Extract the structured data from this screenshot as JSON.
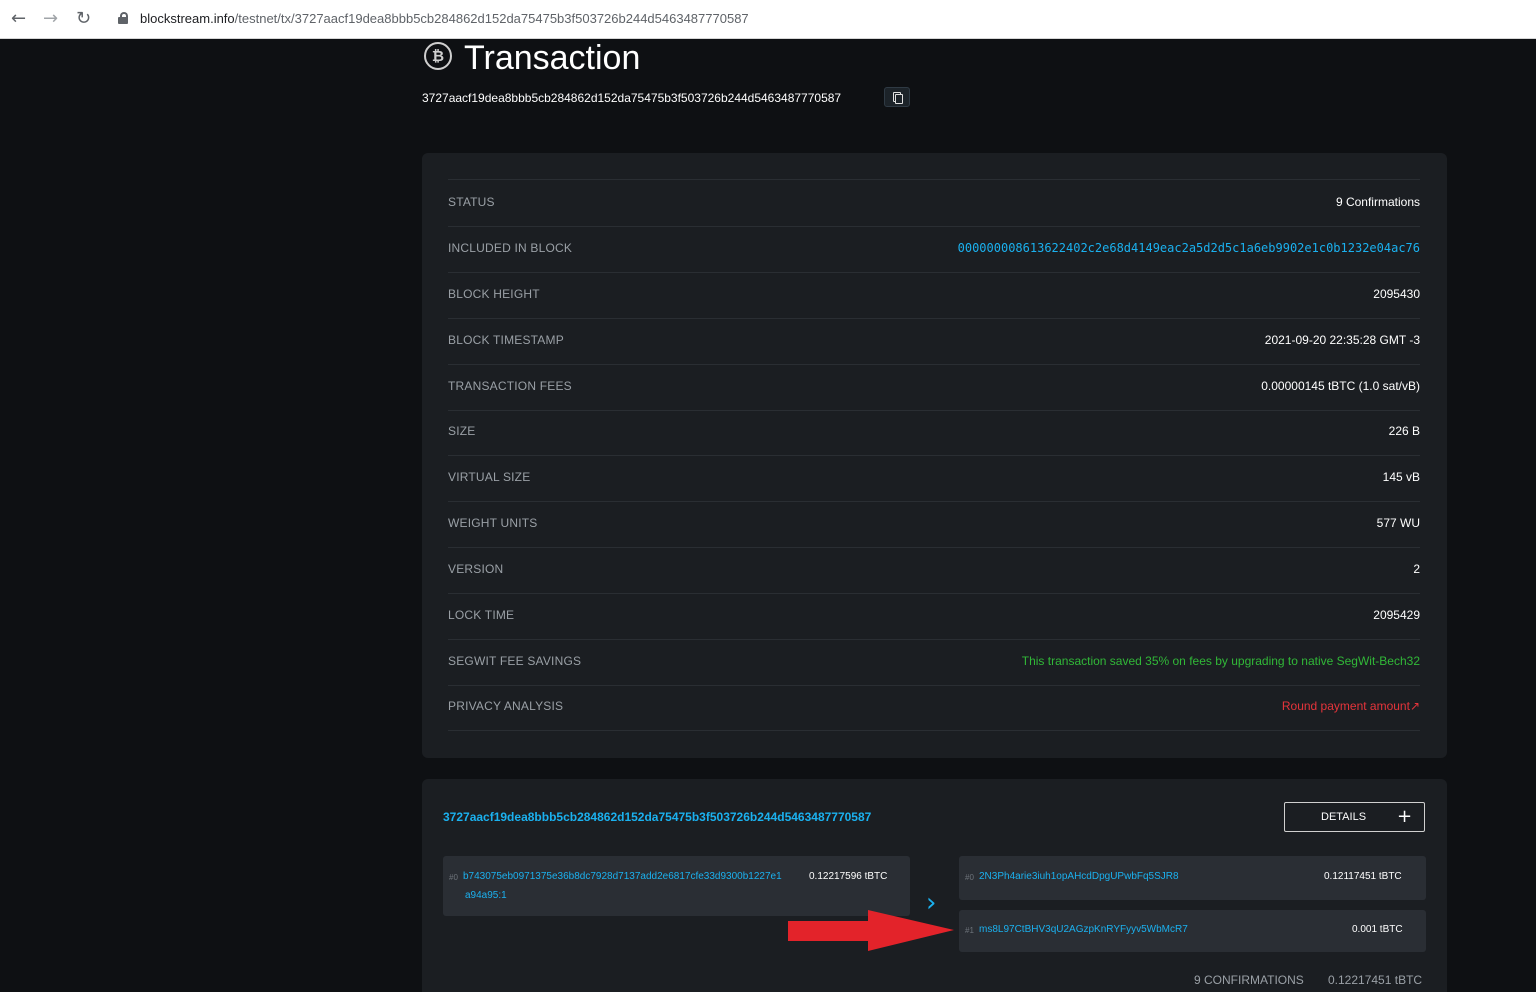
{
  "browser": {
    "url_host": "blockstream.info",
    "url_path": "/testnet/tx/3727aacf19dea8bbb5cb284862d152da75475b3f503726b244d5463487770587"
  },
  "header": {
    "title": "Transaction",
    "icon": "bitcoin-icon",
    "txid": "3727aacf19dea8bbb5cb284862d152da75475b3f503726b244d5463487770587"
  },
  "details": [
    {
      "label": "STATUS",
      "value": "9 Confirmations"
    },
    {
      "label": "INCLUDED IN BLOCK",
      "value": "000000008613622402c2e68d4149eac2a5d2d5c1a6eb9902e1c0b1232e04ac76"
    },
    {
      "label": "BLOCK HEIGHT",
      "value": "2095430"
    },
    {
      "label": "BLOCK TIMESTAMP",
      "value": "2021-09-20 22:35:28 GMT -3"
    },
    {
      "label": "TRANSACTION FEES",
      "value": "0.00000145 tBTC (1.0 sat/vB)"
    },
    {
      "label": "SIZE",
      "value": "226 B"
    },
    {
      "label": "VIRTUAL SIZE",
      "value": "145 vB"
    },
    {
      "label": "WEIGHT UNITS",
      "value": "577 WU"
    },
    {
      "label": "VERSION",
      "value": "2"
    },
    {
      "label": "LOCK TIME",
      "value": "2095429"
    },
    {
      "label": "SEGWIT FEE SAVINGS",
      "value": "This transaction saved 35% on fees by upgrading to native SegWit-Bech32"
    },
    {
      "label": "PRIVACY ANALYSIS",
      "value": "Round payment amount↗"
    }
  ],
  "io": {
    "txid": "3727aacf19dea8bbb5cb284862d152da75475b3f503726b244d5463487770587",
    "details_label": "DETAILS",
    "details_icon": "plus-icon",
    "inputs": [
      {
        "index": "#0",
        "address_line1": "b743075eb0971375e36b8dc7928d7137add2e6817cfe33d9300b1227e1",
        "address_line2": "a94a95:1",
        "amount": "0.12217596 tBTC"
      }
    ],
    "outputs": [
      {
        "index": "#0",
        "address": "2N3Ph4arie3iuh1opAHcdDpgUPwbFq5SJR8",
        "amount": "0.12117451 tBTC"
      },
      {
        "index": "#1",
        "address": "ms8L97CtBHV3qU2AGzpKnRYFyyv5WbMcR7",
        "amount": "0.001 tBTC"
      }
    ],
    "confirmations": "9 CONFIRMATIONS",
    "total": "0.12217451 tBTC"
  },
  "colors": {
    "background": "#0e1013",
    "card": "#1b1e22",
    "link": "#1bb1ef",
    "success": "#31b838",
    "warning": "#e5343b",
    "annotation_arrow": "#e3232a"
  }
}
